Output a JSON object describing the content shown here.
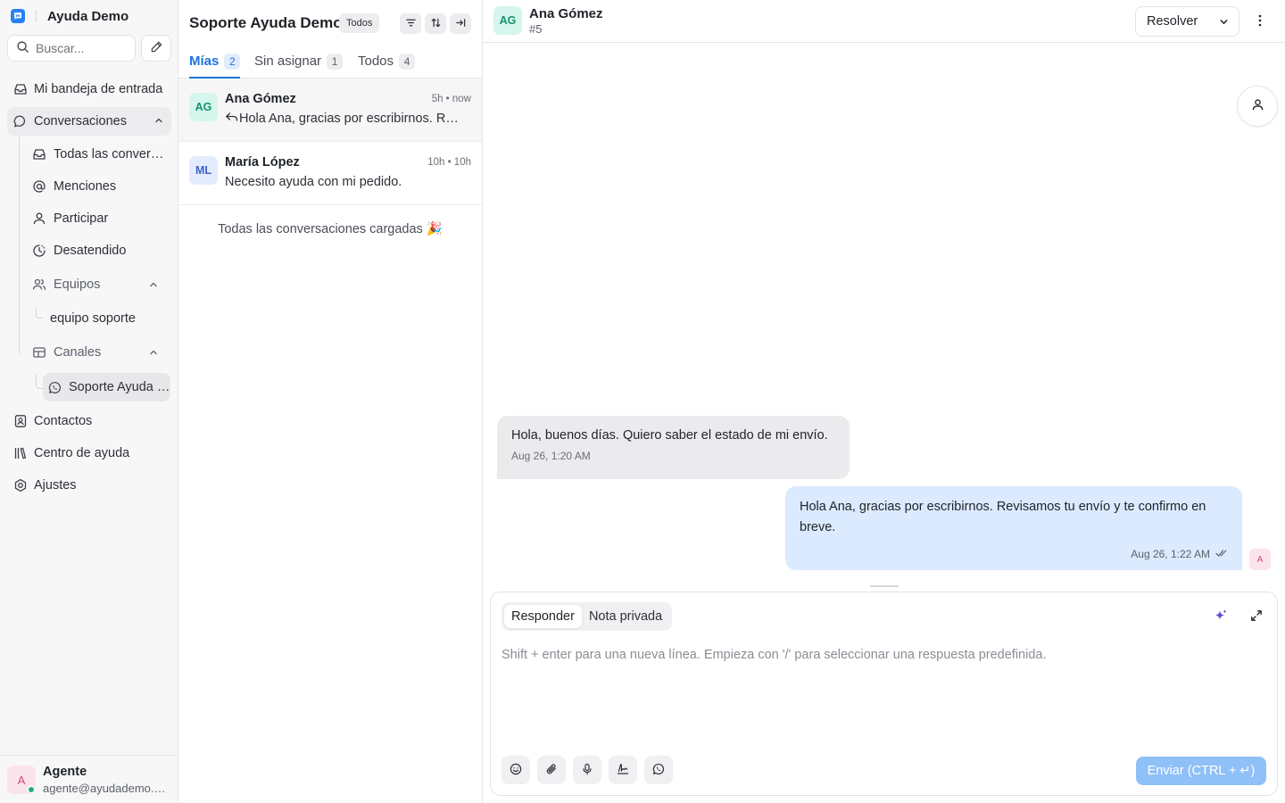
{
  "sidebar": {
    "brand": "Ayuda Demo",
    "search_placeholder": "Buscar...",
    "inbox": "Mi bandeja de entrada",
    "conversations": "Conversaciones",
    "sub": {
      "all": "Todas las conversaciones",
      "mentions": "Menciones",
      "participating": "Participar",
      "unattended": "Desatendido",
      "teams": "Equipos",
      "team_item": "equipo soporte",
      "channels": "Canales",
      "channel_item": "Soporte Ayuda Demo"
    },
    "contacts": "Contactos",
    "help_center": "Centro de ayuda",
    "settings": "Ajustes",
    "user": {
      "initial": "A",
      "name": "Agente",
      "email": "agente@ayudademo.com"
    }
  },
  "list": {
    "title": "Soporte Ayuda Demo",
    "filter_chip": "Todos",
    "tabs": [
      {
        "label": "Mías",
        "count": "2"
      },
      {
        "label": "Sin asignar",
        "count": "1"
      },
      {
        "label": "Todos",
        "count": "4"
      }
    ],
    "conversations": [
      {
        "initials": "AG",
        "name": "Ana Gómez",
        "time": "5h • now",
        "preview": "Hola Ana, gracias por escribirnos. Revisamos tu envío y te confirmo en breve."
      },
      {
        "initials": "ML",
        "name": "María López",
        "time": "10h • 10h",
        "preview": "Necesito ayuda con mi pedido."
      }
    ],
    "all_loaded": "Todas las conversaciones cargadas 🎉"
  },
  "pane": {
    "contact_initials": "AG",
    "contact_name": "Ana Gómez",
    "conversation_id": "#5",
    "resolve_label": "Resolver",
    "messages": [
      {
        "direction": "incoming",
        "text": "Hola, buenos días. Quiero saber el estado de mi envío.",
        "time": "Aug 26, 1:20 AM"
      },
      {
        "direction": "outgoing",
        "text": "Hola Ana, gracias por escribirnos. Revisamos tu envío y te confirmo en breve.",
        "time": "Aug 26, 1:22 AM",
        "sender_initial": "A"
      }
    ],
    "composer": {
      "reply_tab": "Responder",
      "private_tab": "Nota privada",
      "placeholder": "Shift + enter para una nueva línea. Empieza con '/' para seleccionar una respuesta predefinida.",
      "send_label": "Enviar (CTRL + ↵)"
    }
  },
  "colors": {
    "accent": "#1e73d8",
    "send_disabled": "#8fc0f7",
    "incoming_bubble": "#ebebee",
    "outgoing_bubble": "#dbeafe"
  }
}
